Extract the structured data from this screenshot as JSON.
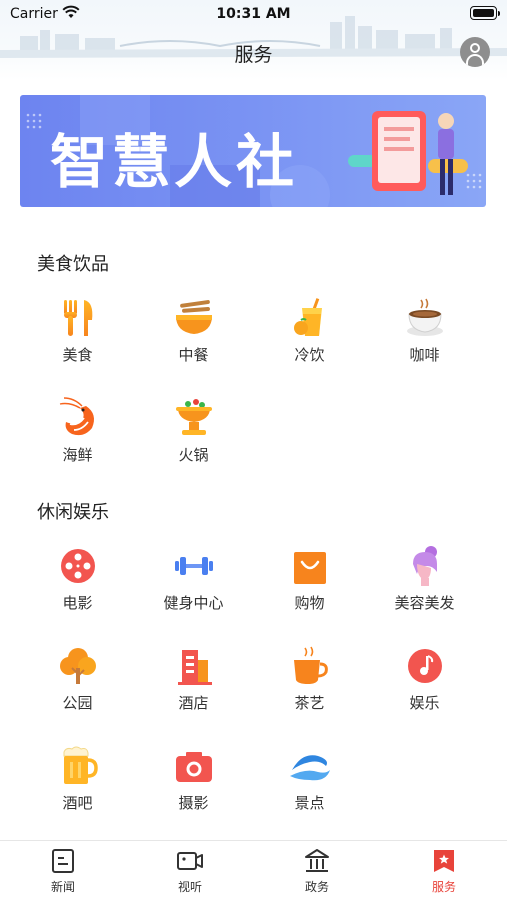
{
  "status_bar": {
    "carrier": "Carrier",
    "time": "10:31 AM"
  },
  "header": {
    "title": "服务"
  },
  "banner": {
    "text": "智慧人社"
  },
  "sections": [
    {
      "title": "美食饮品",
      "items": [
        {
          "label": "美食",
          "icon": "fork-knife-icon"
        },
        {
          "label": "中餐",
          "icon": "noodle-bowl-icon"
        },
        {
          "label": "冷饮",
          "icon": "cold-drink-icon"
        },
        {
          "label": "咖啡",
          "icon": "coffee-cup-icon"
        },
        {
          "label": "海鲜",
          "icon": "shrimp-icon"
        },
        {
          "label": "火锅",
          "icon": "hotpot-icon"
        }
      ]
    },
    {
      "title": "休闲娱乐",
      "items": [
        {
          "label": "电影",
          "icon": "film-reel-icon"
        },
        {
          "label": "健身中心",
          "icon": "dumbbell-icon"
        },
        {
          "label": "购物",
          "icon": "shopping-bag-icon"
        },
        {
          "label": "美容美发",
          "icon": "hair-salon-icon"
        },
        {
          "label": "公园",
          "icon": "tree-icon"
        },
        {
          "label": "酒店",
          "icon": "hotel-building-icon"
        },
        {
          "label": "茶艺",
          "icon": "tea-cup-icon"
        },
        {
          "label": "娱乐",
          "icon": "music-note-icon"
        },
        {
          "label": "酒吧",
          "icon": "beer-mug-icon"
        },
        {
          "label": "摄影",
          "icon": "camera-icon"
        },
        {
          "label": "景点",
          "icon": "scenic-wave-icon"
        }
      ]
    }
  ],
  "tabbar": {
    "items": [
      {
        "label": "新闻",
        "icon": "news-icon"
      },
      {
        "label": "视听",
        "icon": "video-icon"
      },
      {
        "label": "政务",
        "icon": "government-icon"
      },
      {
        "label": "服务",
        "icon": "service-icon",
        "active": true
      }
    ]
  },
  "colors": {
    "accent": "#e8433a",
    "orange": "#f7941d",
    "banner": "#7a93f3"
  }
}
